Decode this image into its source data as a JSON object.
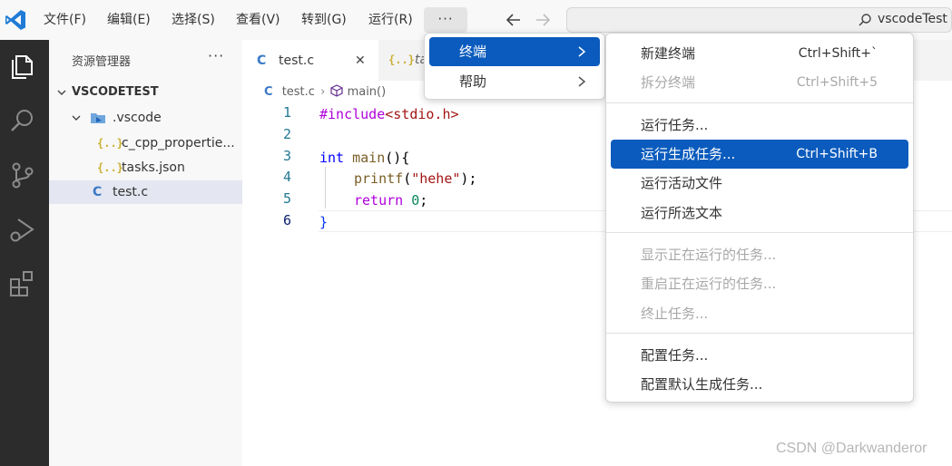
{
  "titlebar": {
    "menus": [
      "文件(F)",
      "编辑(E)",
      "选择(S)",
      "查看(V)",
      "转到(G)",
      "运行(R)"
    ],
    "more_label": "···",
    "search_text": "vscodeTest"
  },
  "sidebar": {
    "title": "资源管理器",
    "more_label": "···",
    "root": "VSCODETEST",
    "folder": ".vscode",
    "files": [
      {
        "icon": "{..}",
        "name": "c_cpp_propertie..."
      },
      {
        "icon": "{..}",
        "name": "tasks.json"
      },
      {
        "icon": "C",
        "name": "test.c"
      }
    ]
  },
  "editor": {
    "tabs": [
      {
        "icon": "C",
        "label": "test.c",
        "close": "✕"
      },
      {
        "icon": "{..}",
        "label": "ta"
      }
    ],
    "breadcrumb": {
      "file": "test.c",
      "symbol": "main()"
    },
    "line_numbers": [
      "1",
      "2",
      "3",
      "4",
      "5",
      "6"
    ],
    "code": {
      "l1_pre": "#include",
      "l1_inc": "<stdio.h>",
      "l3_kw": "int",
      "l3_fn": " main",
      "l3_rest": "(){",
      "l4_fn": "printf",
      "l4_open": "(",
      "l4_str": "\"hehe\"",
      "l4_close": ");",
      "l5_kw": "return",
      "l5_num": "0",
      "l5_end": ";",
      "l6_brace": "}"
    }
  },
  "menu_terminal": {
    "items": [
      {
        "label": "终端",
        "highlighted": true
      },
      {
        "label": "帮助",
        "highlighted": false
      }
    ]
  },
  "menu_terminal_sub": {
    "items": [
      {
        "label": "新建终端",
        "key": "Ctrl+Shift+`",
        "disabled": false
      },
      {
        "label": "拆分终端",
        "key": "Ctrl+Shift+5",
        "disabled": true
      },
      {
        "label": "运行任务...",
        "key": "",
        "disabled": false
      },
      {
        "label": "运行生成任务...",
        "key": "Ctrl+Shift+B",
        "disabled": false,
        "highlighted": true
      },
      {
        "label": "运行活动文件",
        "key": "",
        "disabled": false
      },
      {
        "label": "运行所选文本",
        "key": "",
        "disabled": false
      },
      {
        "label": "显示正在运行的任务...",
        "key": "",
        "disabled": true
      },
      {
        "label": "重启正在运行的任务...",
        "key": "",
        "disabled": true
      },
      {
        "label": "终止任务...",
        "key": "",
        "disabled": true
      },
      {
        "label": "配置任务...",
        "key": "",
        "disabled": false
      },
      {
        "label": "配置默认生成任务...",
        "key": "",
        "disabled": false
      }
    ]
  },
  "watermark": "CSDN @Darkwanderor",
  "colors": {
    "accent": "#0a5bbd",
    "activitybar": "#2c2c2c",
    "sidebar": "#f8f8f8"
  }
}
